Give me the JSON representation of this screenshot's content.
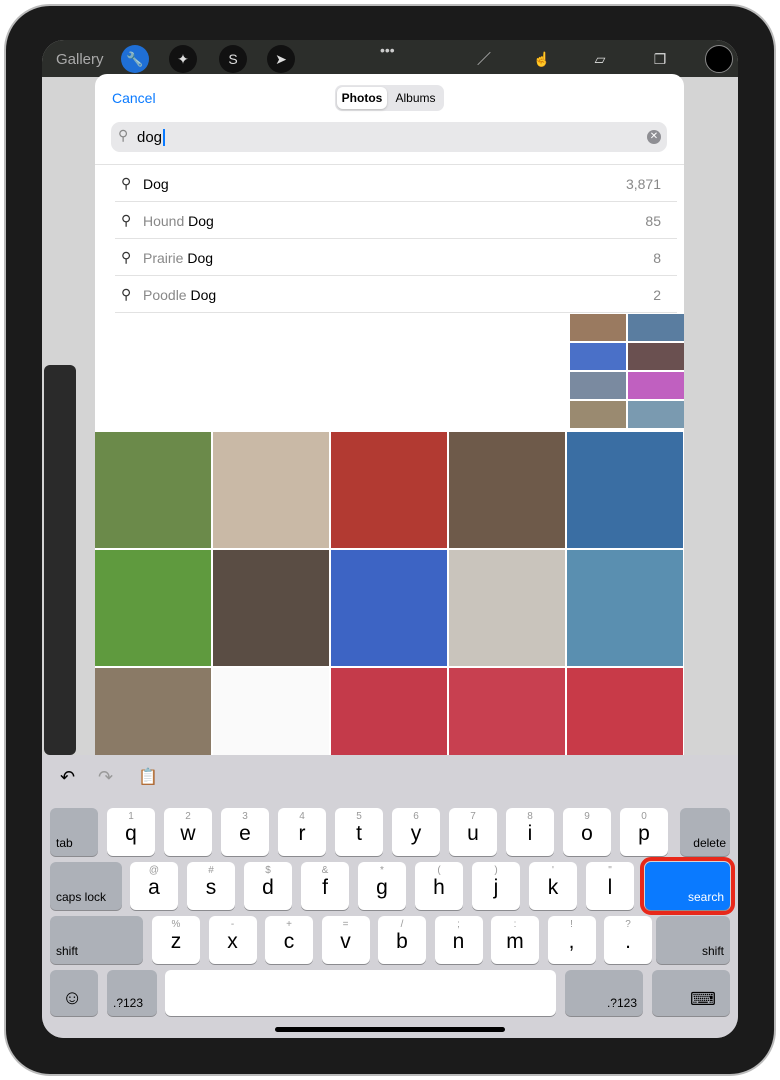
{
  "toolbar": {
    "gallery": "Gallery",
    "icons": [
      "wrench-icon",
      "magic-wand-icon",
      "selection-s-icon",
      "arrow-cursor-icon",
      "more-dots-icon",
      "brush-icon",
      "smudge-icon",
      "eraser-icon",
      "layers-icon",
      "color-swatch-icon"
    ],
    "more": "•••"
  },
  "modal": {
    "cancel": "Cancel",
    "tabs": [
      "Photos",
      "Albums"
    ],
    "search_value": "dog"
  },
  "suggestions": [
    {
      "prefix": "",
      "term": "Dog",
      "count": "3,871"
    },
    {
      "prefix": "Hound ",
      "term": "Dog",
      "count": "85"
    },
    {
      "prefix": "Prairie ",
      "term": "Dog",
      "count": "8"
    },
    {
      "prefix": "Poodle ",
      "term": "Dog",
      "count": "2"
    }
  ],
  "keyboard": {
    "row1": [
      [
        "1",
        "q"
      ],
      [
        "2",
        "w"
      ],
      [
        "3",
        "e"
      ],
      [
        "4",
        "r"
      ],
      [
        "5",
        "t"
      ],
      [
        "6",
        "y"
      ],
      [
        "7",
        "u"
      ],
      [
        "8",
        "i"
      ],
      [
        "9",
        "o"
      ],
      [
        "0",
        "p"
      ]
    ],
    "row2": [
      [
        "@",
        "a"
      ],
      [
        "#",
        "s"
      ],
      [
        "$",
        "d"
      ],
      [
        "&",
        "f"
      ],
      [
        "*",
        "g"
      ],
      [
        "(",
        "h"
      ],
      [
        ")",
        "j"
      ],
      [
        "'",
        "k"
      ],
      [
        "\"",
        "l"
      ]
    ],
    "row3": [
      [
        "%",
        "z"
      ],
      [
        "-",
        "x"
      ],
      [
        "+",
        "c"
      ],
      [
        "=",
        "v"
      ],
      [
        "/",
        "b"
      ],
      [
        ";",
        "n"
      ],
      [
        ":",
        "m"
      ],
      [
        "!",
        ","
      ],
      [
        "?",
        "."
      ]
    ],
    "tab": "tab",
    "delete": "delete",
    "caps": "caps lock",
    "search": "search",
    "shift": "shift",
    "num": ".?123",
    "accent": "#0a7aff",
    "highlight": "#e8281a"
  }
}
